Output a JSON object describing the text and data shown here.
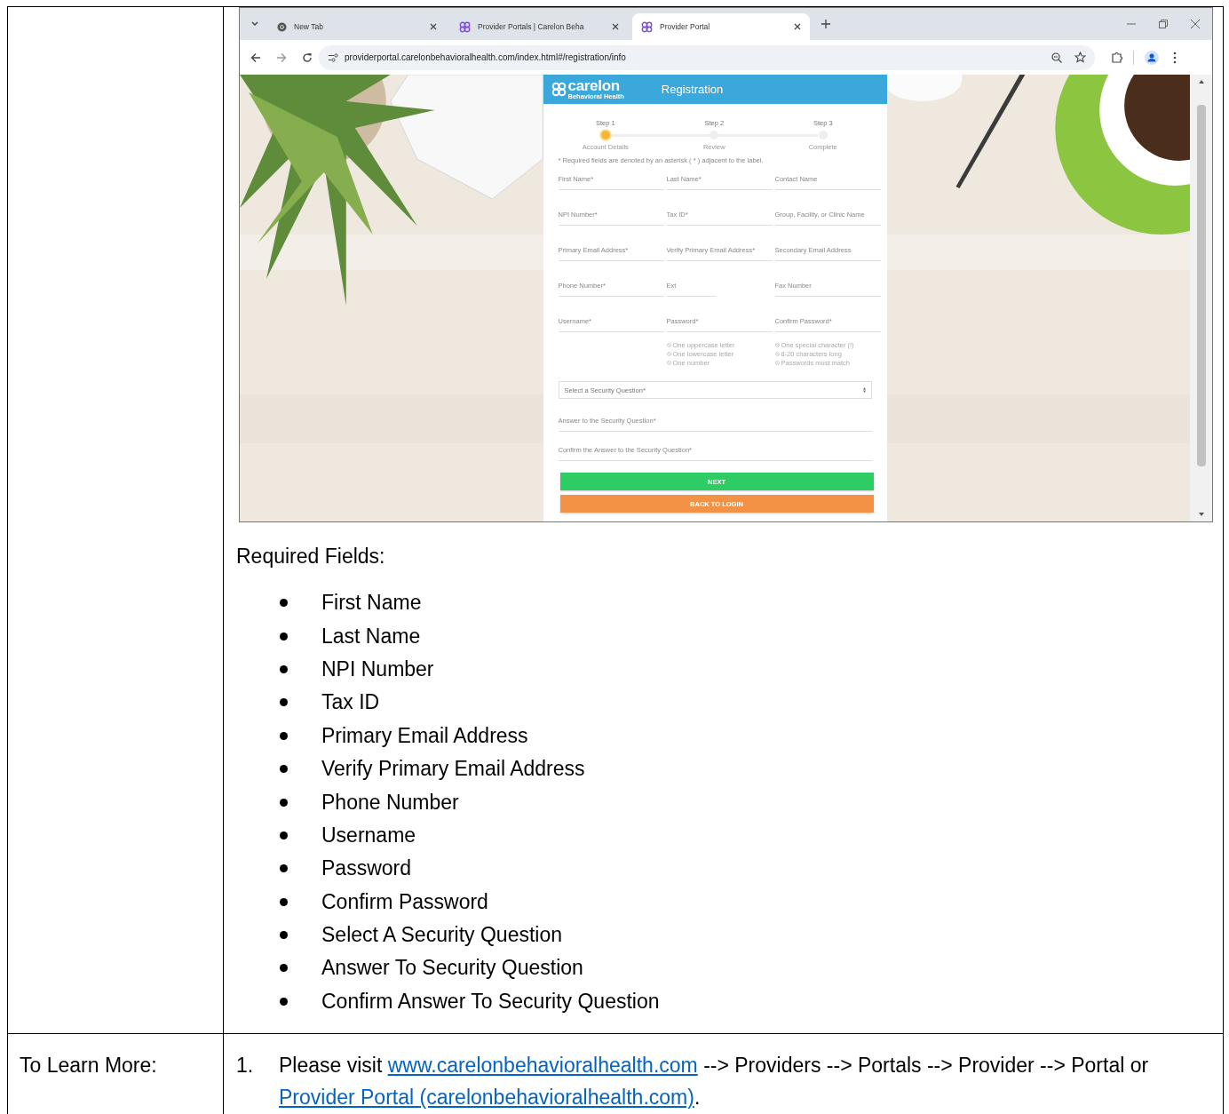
{
  "browser": {
    "tabs": [
      {
        "title": "New Tab",
        "kind": "newtab",
        "selected": false
      },
      {
        "title": "Provider Portals | Carelon Beha",
        "kind": "site",
        "selected": false
      },
      {
        "title": "Provider Portal",
        "kind": "site",
        "selected": true
      }
    ],
    "address": "providerportal.carelonbehavioralhealth.com/index.html#/registration/info"
  },
  "registration": {
    "logo": "carelon",
    "logo_sub": "Behavioral Health",
    "title": "Registration",
    "steps": [
      {
        "label": "Step 1",
        "caption": "Account Details",
        "selected": true
      },
      {
        "label": "Step 2",
        "caption": "Review",
        "selected": false
      },
      {
        "label": "Step 3",
        "caption": "Complete",
        "selected": false
      }
    ],
    "note": "* Required fields are denoted by an asterisk ( * ) adjacent to the label.",
    "fields": [
      {
        "placeholder": "First Name*",
        "kind": "full"
      },
      {
        "placeholder": "Last Name*",
        "kind": "full"
      },
      {
        "placeholder": "Contact Name",
        "kind": "full"
      },
      {
        "placeholder": "NPI Number*",
        "kind": "full"
      },
      {
        "placeholder": "Tax ID*",
        "kind": "full"
      },
      {
        "placeholder": "Group, Facility, or Clinic Name",
        "kind": "full"
      },
      {
        "placeholder": "Primary Email Address*",
        "kind": "full"
      },
      {
        "placeholder": "Verify Primary Email Address*",
        "kind": "full"
      },
      {
        "placeholder": "Secondary Email Address",
        "kind": "full"
      },
      {
        "placeholder": "Phone Number*",
        "kind": "full"
      },
      {
        "placeholder": "Ext",
        "kind": "short"
      },
      {
        "placeholder": "Fax Number",
        "kind": "full"
      },
      {
        "placeholder": "Username*",
        "kind": "full"
      },
      {
        "placeholder": "Password*",
        "kind": "full"
      },
      {
        "placeholder": "Confirm Password*",
        "kind": "full"
      }
    ],
    "password_hints": [
      [
        "One uppercase letter",
        "One lowercase letter",
        "One number"
      ],
      [
        "One special character (!)",
        "8-20 characters long",
        "Passwords must match"
      ]
    ],
    "security_question": {
      "placeholder": "Select a Security Question*"
    },
    "answers": [
      {
        "placeholder": "Answer to the Security Question*"
      },
      {
        "placeholder": "Confirm the Answer to the Security Question*"
      }
    ],
    "buttons": [
      {
        "label": "NEXT",
        "kind": "primary"
      },
      {
        "label": "BACK TO LOGIN",
        "kind": "secondary"
      }
    ]
  },
  "required_heading": "Required Fields:",
  "required_fields": [
    "First Name",
    "Last Name",
    "NPI Number",
    "Tax ID",
    "Primary Email Address",
    "Verify Primary Email Address",
    "Phone Number",
    "Username",
    "Password",
    "Confirm Password",
    "Select A Security Question",
    "Answer To Security Question",
    "Confirm Answer To Security Question"
  ],
  "learn_more": {
    "label": "To Learn More:",
    "items": [
      {
        "number": "1.",
        "parts": [
          {
            "kind": "text",
            "text": "Please visit "
          },
          {
            "kind": "link",
            "text": "www.carelonbehavioralhealth.com"
          },
          {
            "kind": "text",
            "text": " --> Providers --> Portals --> Provider --> Portal or "
          },
          {
            "kind": "link",
            "text": "Provider Portal (carelonbehavioralhealth.com)"
          },
          {
            "kind": "text",
            "text": "."
          }
        ]
      }
    ]
  }
}
